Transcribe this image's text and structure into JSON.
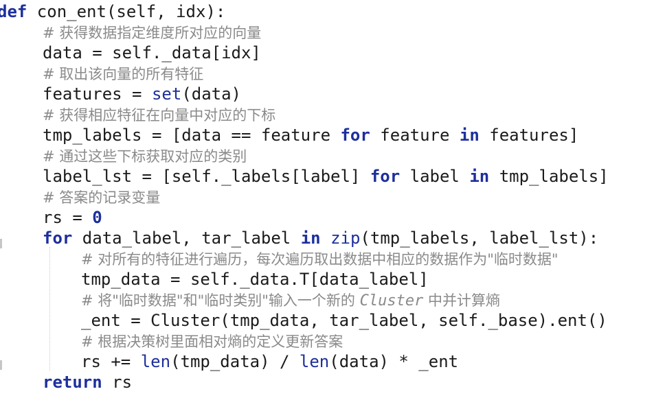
{
  "code": {
    "lines": [
      {
        "indent": 0,
        "tokens": [
          [
            "kw",
            "def"
          ],
          [
            "tx",
            " con_ent(self, idx):"
          ]
        ]
      },
      {
        "indent": 1,
        "tokens": [
          [
            "cm",
            "# 获得数据指定维度所对应的向量"
          ]
        ]
      },
      {
        "indent": 1,
        "tokens": [
          [
            "tx",
            "data = self._data[idx]"
          ]
        ]
      },
      {
        "indent": 1,
        "tokens": [
          [
            "cm",
            "# 取出该向量的所有特征"
          ]
        ]
      },
      {
        "indent": 1,
        "tokens": [
          [
            "tx",
            "features = "
          ],
          [
            "bi",
            "set"
          ],
          [
            "tx",
            "(data)"
          ]
        ]
      },
      {
        "indent": 1,
        "tokens": [
          [
            "cm",
            "# 获得相应特征在向量中对应的下标"
          ]
        ]
      },
      {
        "indent": 1,
        "tokens": [
          [
            "tx",
            "tmp_labels = [data == feature "
          ],
          [
            "kw",
            "for"
          ],
          [
            "tx",
            " feature "
          ],
          [
            "kw",
            "in"
          ],
          [
            "tx",
            " features]"
          ]
        ]
      },
      {
        "indent": 1,
        "tokens": [
          [
            "cm",
            "# 通过这些下标获取对应的类别"
          ]
        ]
      },
      {
        "indent": 1,
        "tokens": [
          [
            "tx",
            "label_lst = [self._labels[label] "
          ],
          [
            "kw",
            "for"
          ],
          [
            "tx",
            " label "
          ],
          [
            "kw",
            "in"
          ],
          [
            "tx",
            " tmp_labels]"
          ]
        ]
      },
      {
        "indent": 1,
        "tokens": [
          [
            "cm",
            "# 答案的记录变量"
          ]
        ]
      },
      {
        "indent": 1,
        "tokens": [
          [
            "tx",
            "rs = "
          ],
          [
            "num",
            "0"
          ]
        ]
      },
      {
        "indent": 1,
        "tokens": [
          [
            "kw",
            "for"
          ],
          [
            "tx",
            " data_label, tar_label "
          ],
          [
            "kw",
            "in"
          ],
          [
            "tx",
            " "
          ],
          [
            "bi",
            "zip"
          ],
          [
            "tx",
            "(tmp_labels, label_lst):"
          ]
        ]
      },
      {
        "indent": 2,
        "tokens": [
          [
            "cm",
            "# 对所有的特征进行遍历，每次遍历取出数据中相应的数据作为\"临时数据\""
          ]
        ]
      },
      {
        "indent": 2,
        "tokens": [
          [
            "tx",
            "tmp_data = self._data.T[data_label]"
          ]
        ]
      },
      {
        "indent": 2,
        "tokens": [
          [
            "cm",
            "# 将\"临时数据\"和\"临时类别\"输入一个新的 "
          ],
          [
            "cmi",
            "Cluster"
          ],
          [
            "cm",
            " 中并计算熵"
          ]
        ]
      },
      {
        "indent": 2,
        "tokens": [
          [
            "tx",
            "_ent = Cluster(tmp_data, tar_label, self._base).ent()"
          ]
        ]
      },
      {
        "indent": 2,
        "tokens": [
          [
            "cm",
            "# 根据决策树里面相对熵的定义更新答案"
          ]
        ]
      },
      {
        "indent": 2,
        "tokens": [
          [
            "tx",
            "rs += "
          ],
          [
            "bi",
            "len"
          ],
          [
            "tx",
            "(tmp_data) / "
          ],
          [
            "bi",
            "len"
          ],
          [
            "tx",
            "(data) * _ent"
          ]
        ]
      },
      {
        "indent": 1,
        "tokens": [
          [
            "kw",
            "return"
          ],
          [
            "tx",
            " rs"
          ]
        ]
      }
    ]
  },
  "colors": {
    "keyword": "#1d2f9c",
    "comment": "#8a8a8a",
    "text": "#1b1b1b",
    "background": "#ffffff"
  }
}
